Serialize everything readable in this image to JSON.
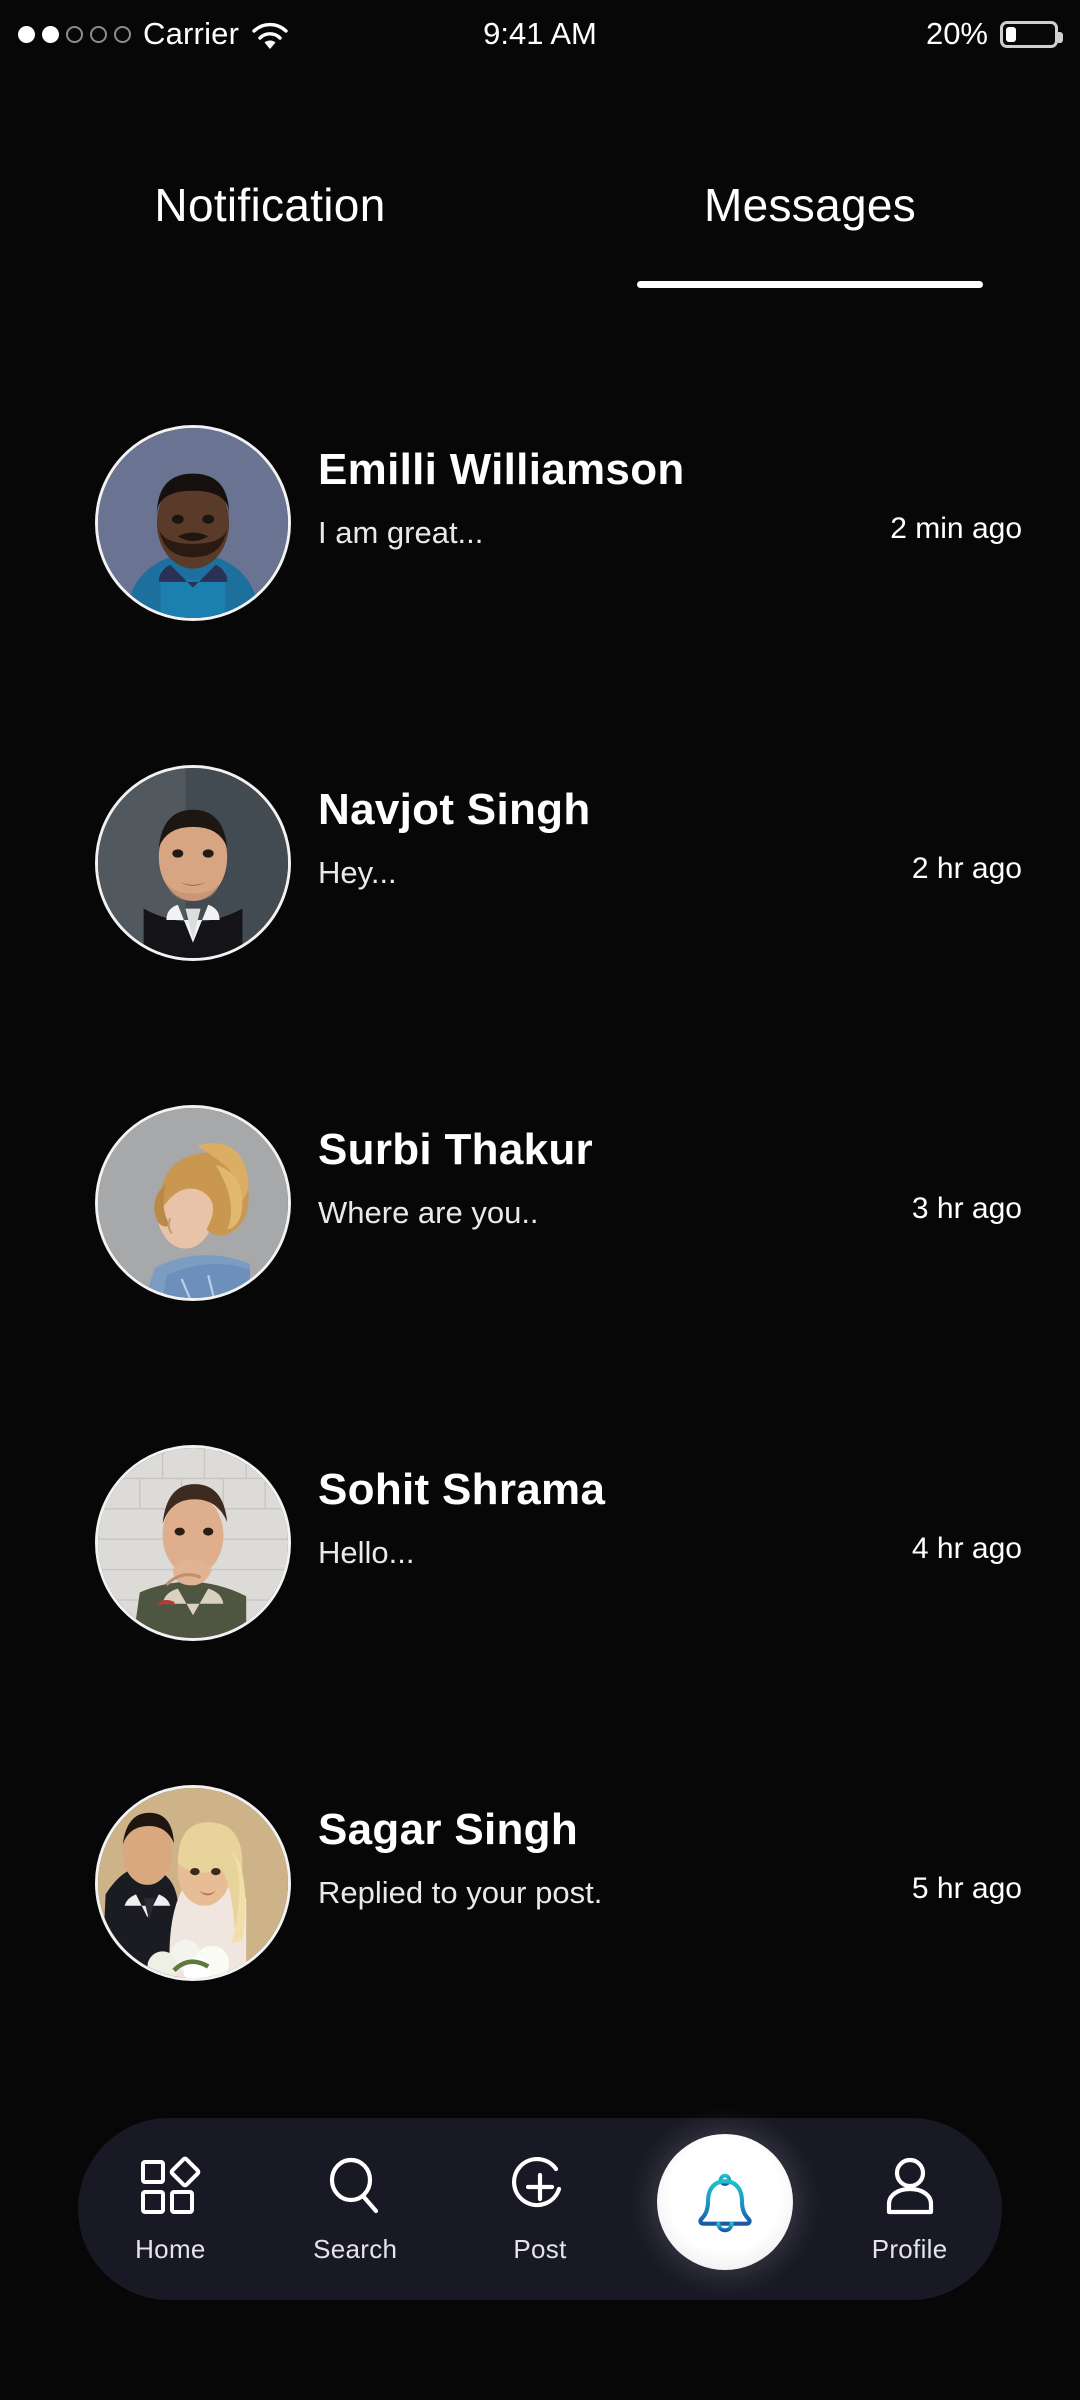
{
  "status_bar": {
    "signal_dots_total": 5,
    "signal_dots_filled": 2,
    "carrier": "Carrier",
    "wifi_icon": "wifi-icon",
    "time": "9:41 AM",
    "battery_percent": "20%",
    "battery_level": 20
  },
  "tabs": {
    "items": [
      {
        "label": "Notification",
        "active": false
      },
      {
        "label": "Messages",
        "active": true
      }
    ]
  },
  "messages": {
    "items": [
      {
        "name": "Emilli Williamson",
        "snippet": "I am great...",
        "time": "2 min ago",
        "avatar": "avatar-man-blue-tshirt"
      },
      {
        "name": "Navjot Singh",
        "snippet": "Hey...",
        "time": "2 hr ago",
        "avatar": "avatar-man-black-suit"
      },
      {
        "name": "Surbi Thakur",
        "snippet": "Where are you..",
        "time": "3 hr ago",
        "avatar": "avatar-woman-denim"
      },
      {
        "name": "Sohit Shrama",
        "snippet": "Hello...",
        "time": "4 hr ago",
        "avatar": "avatar-man-green-jacket"
      },
      {
        "name": "Sagar Singh",
        "snippet": "Replied to your post.",
        "time": "5 hr ago",
        "avatar": "avatar-couple-wedding"
      }
    ]
  },
  "bottom_nav": {
    "items": [
      {
        "label": "Home",
        "icon": "grid-diamond-icon",
        "active": false
      },
      {
        "label": "Search",
        "icon": "search-icon",
        "active": false
      },
      {
        "label": "Post",
        "icon": "plus-circle-icon",
        "active": false
      },
      {
        "label": "",
        "icon": "bell-icon",
        "active": true
      },
      {
        "label": "Profile",
        "icon": "person-icon",
        "active": false
      }
    ]
  },
  "colors": {
    "background": "#070708",
    "nav_background": "#191926",
    "accent_bell_top": "#1bb7c8",
    "accent_bell_bottom": "#1c5fa8",
    "text_primary": "#ffffff",
    "active_tab_underline": "#ffffff"
  }
}
